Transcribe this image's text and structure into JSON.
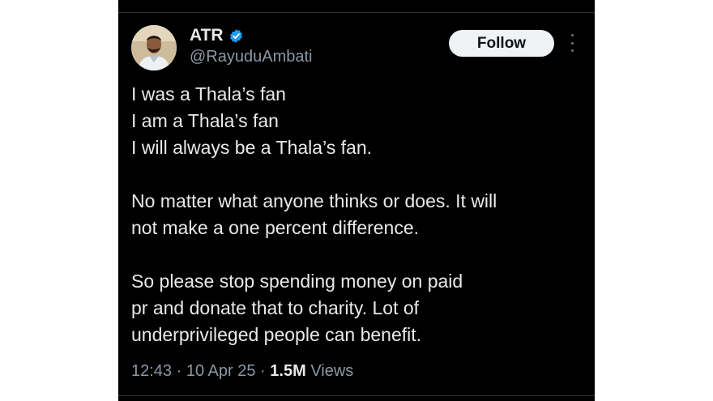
{
  "author": {
    "display_name": "ATR",
    "handle": "@RayuduAmbati",
    "verified_icon": "verified-badge-icon",
    "avatar": "profile-photo"
  },
  "actions": {
    "follow_label": "Follow",
    "more_icon": "more-options-icon"
  },
  "tweet": {
    "paragraphs": [
      [
        "I was a Thala’s fan",
        "I am a Thala’s fan",
        "I will always be a Thala’s fan."
      ],
      [
        "No matter what anyone thinks or does. It will",
        "not make a one percent difference."
      ],
      [
        "So please stop spending money on paid",
        "pr and donate that to charity. Lot of",
        "underprivileged people can benefit."
      ]
    ]
  },
  "meta": {
    "time": "12:43",
    "separator": "·",
    "date": "10 Apr 25",
    "views_count": "1.5M",
    "views_label": "Views"
  },
  "colors": {
    "background": "#000000",
    "text": "#e7e9ea",
    "secondary_text": "#8b98a5",
    "verified_blue": "#1d9bf0",
    "follow_button_bg": "#eff3f4"
  }
}
